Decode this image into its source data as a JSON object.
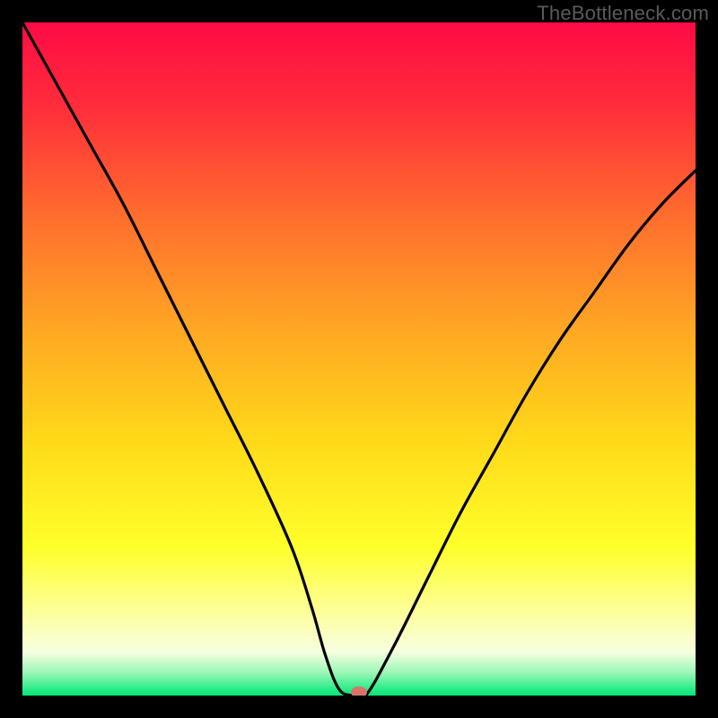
{
  "watermark": "TheBottleneck.com",
  "chart_data": {
    "type": "line",
    "title": "",
    "xlabel": "",
    "ylabel": "",
    "xlim": [
      0,
      100
    ],
    "ylim": [
      0,
      100
    ],
    "series": [
      {
        "name": "bottleneck-curve",
        "x": [
          0,
          5,
          10,
          15,
          20,
          25,
          30,
          35,
          40,
          43,
          45,
          47,
          49,
          51,
          55,
          60,
          65,
          70,
          75,
          80,
          85,
          90,
          95,
          100
        ],
        "y": [
          100,
          91,
          82,
          73,
          63,
          53,
          43,
          33,
          22,
          13,
          6,
          1,
          0,
          0,
          7,
          17,
          27,
          36,
          45,
          53,
          60,
          67,
          73,
          78
        ]
      }
    ],
    "marker": {
      "x": 50,
      "y": 0.5,
      "color": "#d9746b"
    },
    "gradient_stops": [
      {
        "offset": 0.0,
        "color": "#ff0b45"
      },
      {
        "offset": 0.12,
        "color": "#ff2b3b"
      },
      {
        "offset": 0.28,
        "color": "#ff6a2e"
      },
      {
        "offset": 0.45,
        "color": "#ffa524"
      },
      {
        "offset": 0.62,
        "color": "#ffd919"
      },
      {
        "offset": 0.78,
        "color": "#ffff2a"
      },
      {
        "offset": 0.88,
        "color": "#fdffa0"
      },
      {
        "offset": 0.935,
        "color": "#f6ffe0"
      },
      {
        "offset": 0.965,
        "color": "#9ef7b8"
      },
      {
        "offset": 1.0,
        "color": "#00e876"
      }
    ]
  }
}
